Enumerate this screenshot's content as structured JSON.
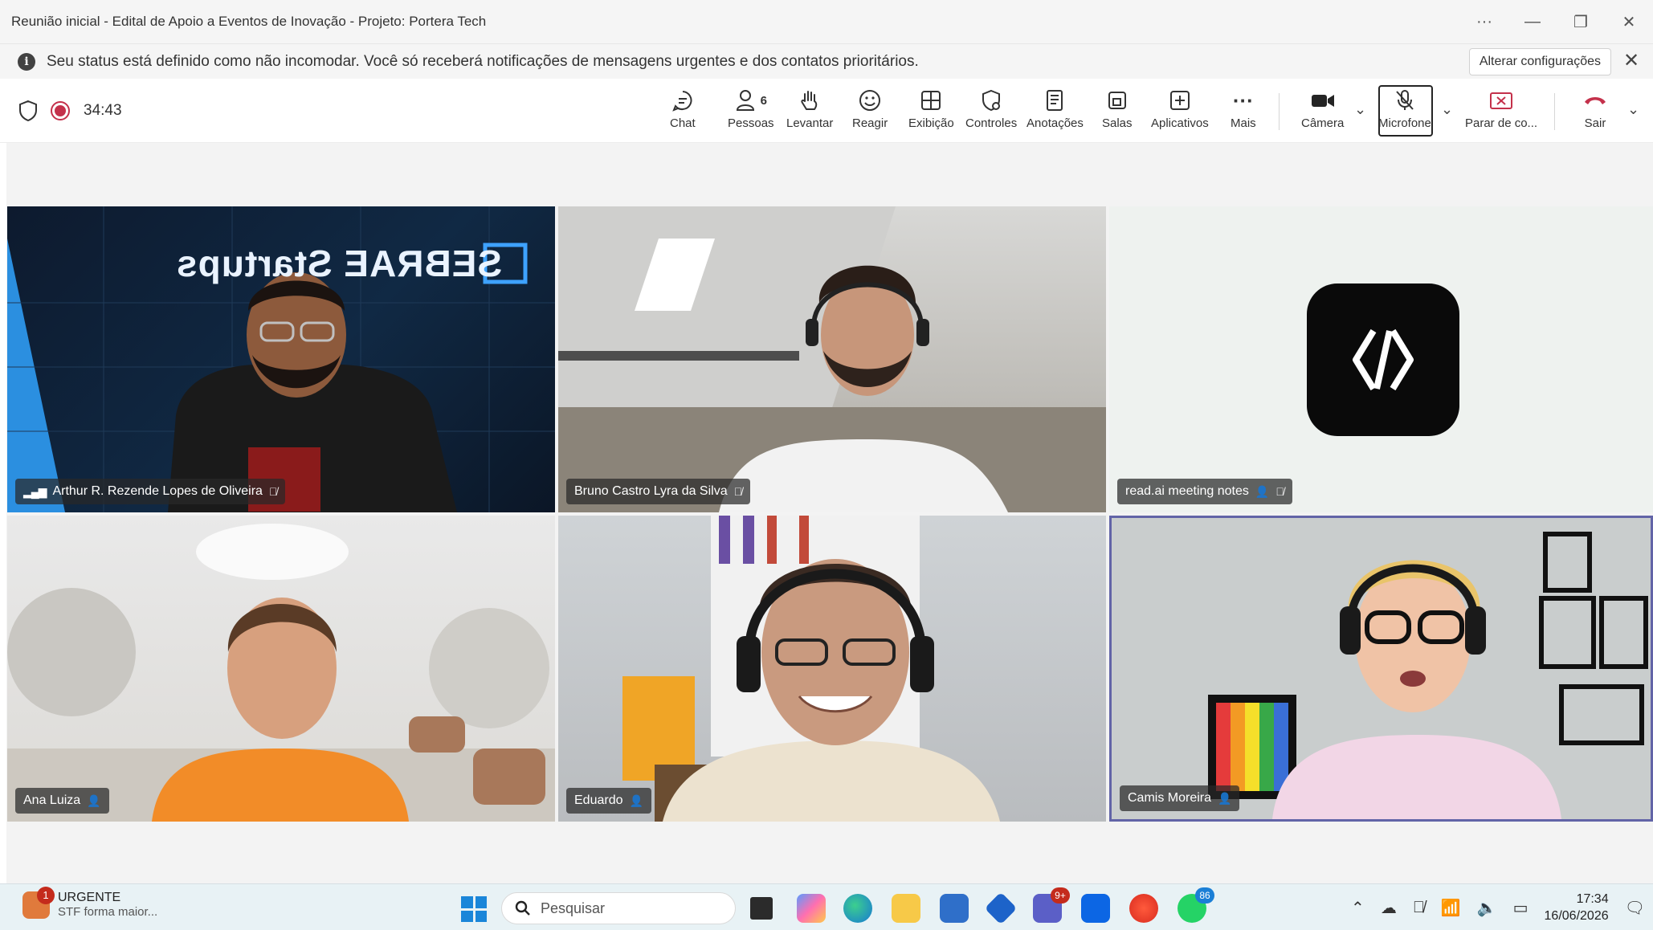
{
  "window": {
    "title": "Reunião inicial - Edital de Apoio a Eventos de Inovação - Projeto: Portera Tech"
  },
  "notification": {
    "message": "Seu status está definido como não incomodar. Você só receberá notificações de mensagens urgentes e dos contatos prioritários.",
    "settings_button": "Alterar configurações"
  },
  "meeting": {
    "timer": "34:43",
    "people_count": "6",
    "toolbar": {
      "chat": "Chat",
      "people": "Pessoas",
      "raise": "Levantar",
      "react": "Reagir",
      "view": "Exibição",
      "controls": "Controles",
      "notes": "Anotações",
      "rooms": "Salas",
      "apps": "Aplicativos",
      "more": "Mais",
      "camera": "Câmera",
      "microphone": "Microfone",
      "stop_share": "Parar de co...",
      "leave": "Sair"
    }
  },
  "participants": [
    {
      "name": "Arthur R. Rezende Lopes de Oliveira",
      "muted": true,
      "speaking_indicator": true
    },
    {
      "name": "Bruno Castro Lyra da Silva",
      "muted": true
    },
    {
      "name": "read.ai meeting notes",
      "muted": true
    },
    {
      "name": "Ana Luiza"
    },
    {
      "name": "Eduardo"
    },
    {
      "name": "Camis Moreira",
      "active_speaker": true
    }
  ],
  "tile_text": {
    "sebrae_logo": "SEBRAE Startups"
  },
  "taskbar": {
    "news_title": "URGENTE",
    "news_sub": "STF forma maior...",
    "news_badge": "1",
    "search_placeholder": "Pesquisar",
    "teams_badge": "9+",
    "whatsapp_badge": "86",
    "time": "17:34",
    "date": "16/06/2026"
  },
  "colors": {
    "active_speaker_border": "#6264a7",
    "record_red": "#c4314b",
    "leave_red": "#c4314b",
    "taskbar_bg": "#e8f2f5"
  }
}
